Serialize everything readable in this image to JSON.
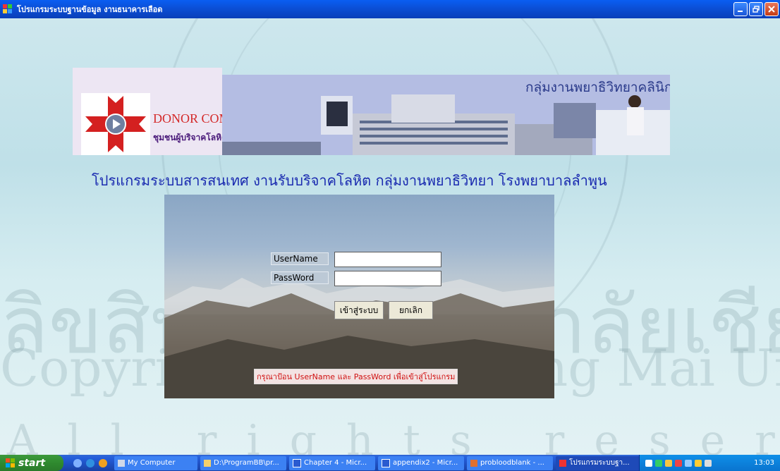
{
  "window": {
    "title": "โปรแกรมระบบฐานข้อมูล งานธนาคารเลือด",
    "buttons": [
      "minimize",
      "maximize",
      "close"
    ]
  },
  "banner": {
    "heading": "กลุ่มงานพยาธิวิทยาคลินิก โรงพยาบาลลำพูน",
    "logo_en": "DONOR COMMUNITY",
    "logo_th": "ชุมชนผู้บริจาคโลหิต จังหวัดลำพูน"
  },
  "program_title": "โปรแกรมระบบสารสนเทศ งานรับบริจาคโลหิต กลุ่มงานพยาธิวิทยา โรงพยาบาลลำพูน",
  "login": {
    "username_label": "UserName",
    "password_label": "PassWord",
    "username_value": "",
    "password_value": "",
    "login_button": "เข้าสู่ระบบ",
    "cancel_button": "ยกเลิก",
    "hint": "กรุณาป้อน UserName และ PassWord เพื่อเข้าสู่โปรแกรม"
  },
  "watermark": {
    "thai": "ลิขสิทธิ์มหาวิทยาลัยเชียงใหม่",
    "copyright": "Copyright © by Chiang Mai University",
    "rights": "All rights reserved"
  },
  "taskbar": {
    "start_label": "start",
    "tasks": [
      "My Computer",
      "D:\\ProgramBB\\pr...",
      "Chapter 4 - Micr...",
      "appendix2 - Micr...",
      "probloodblank - ...",
      "โปรแกรมระบบฐา..."
    ],
    "clock": "13:03"
  },
  "colors": {
    "titlebar": "#0b4fd6",
    "title_text_blue": "#1a2ab0",
    "hint_red": "#d01010",
    "logo_red": "#d42a2a",
    "taskbar_blue": "#245edb",
    "start_green": "#2f8a2f"
  }
}
